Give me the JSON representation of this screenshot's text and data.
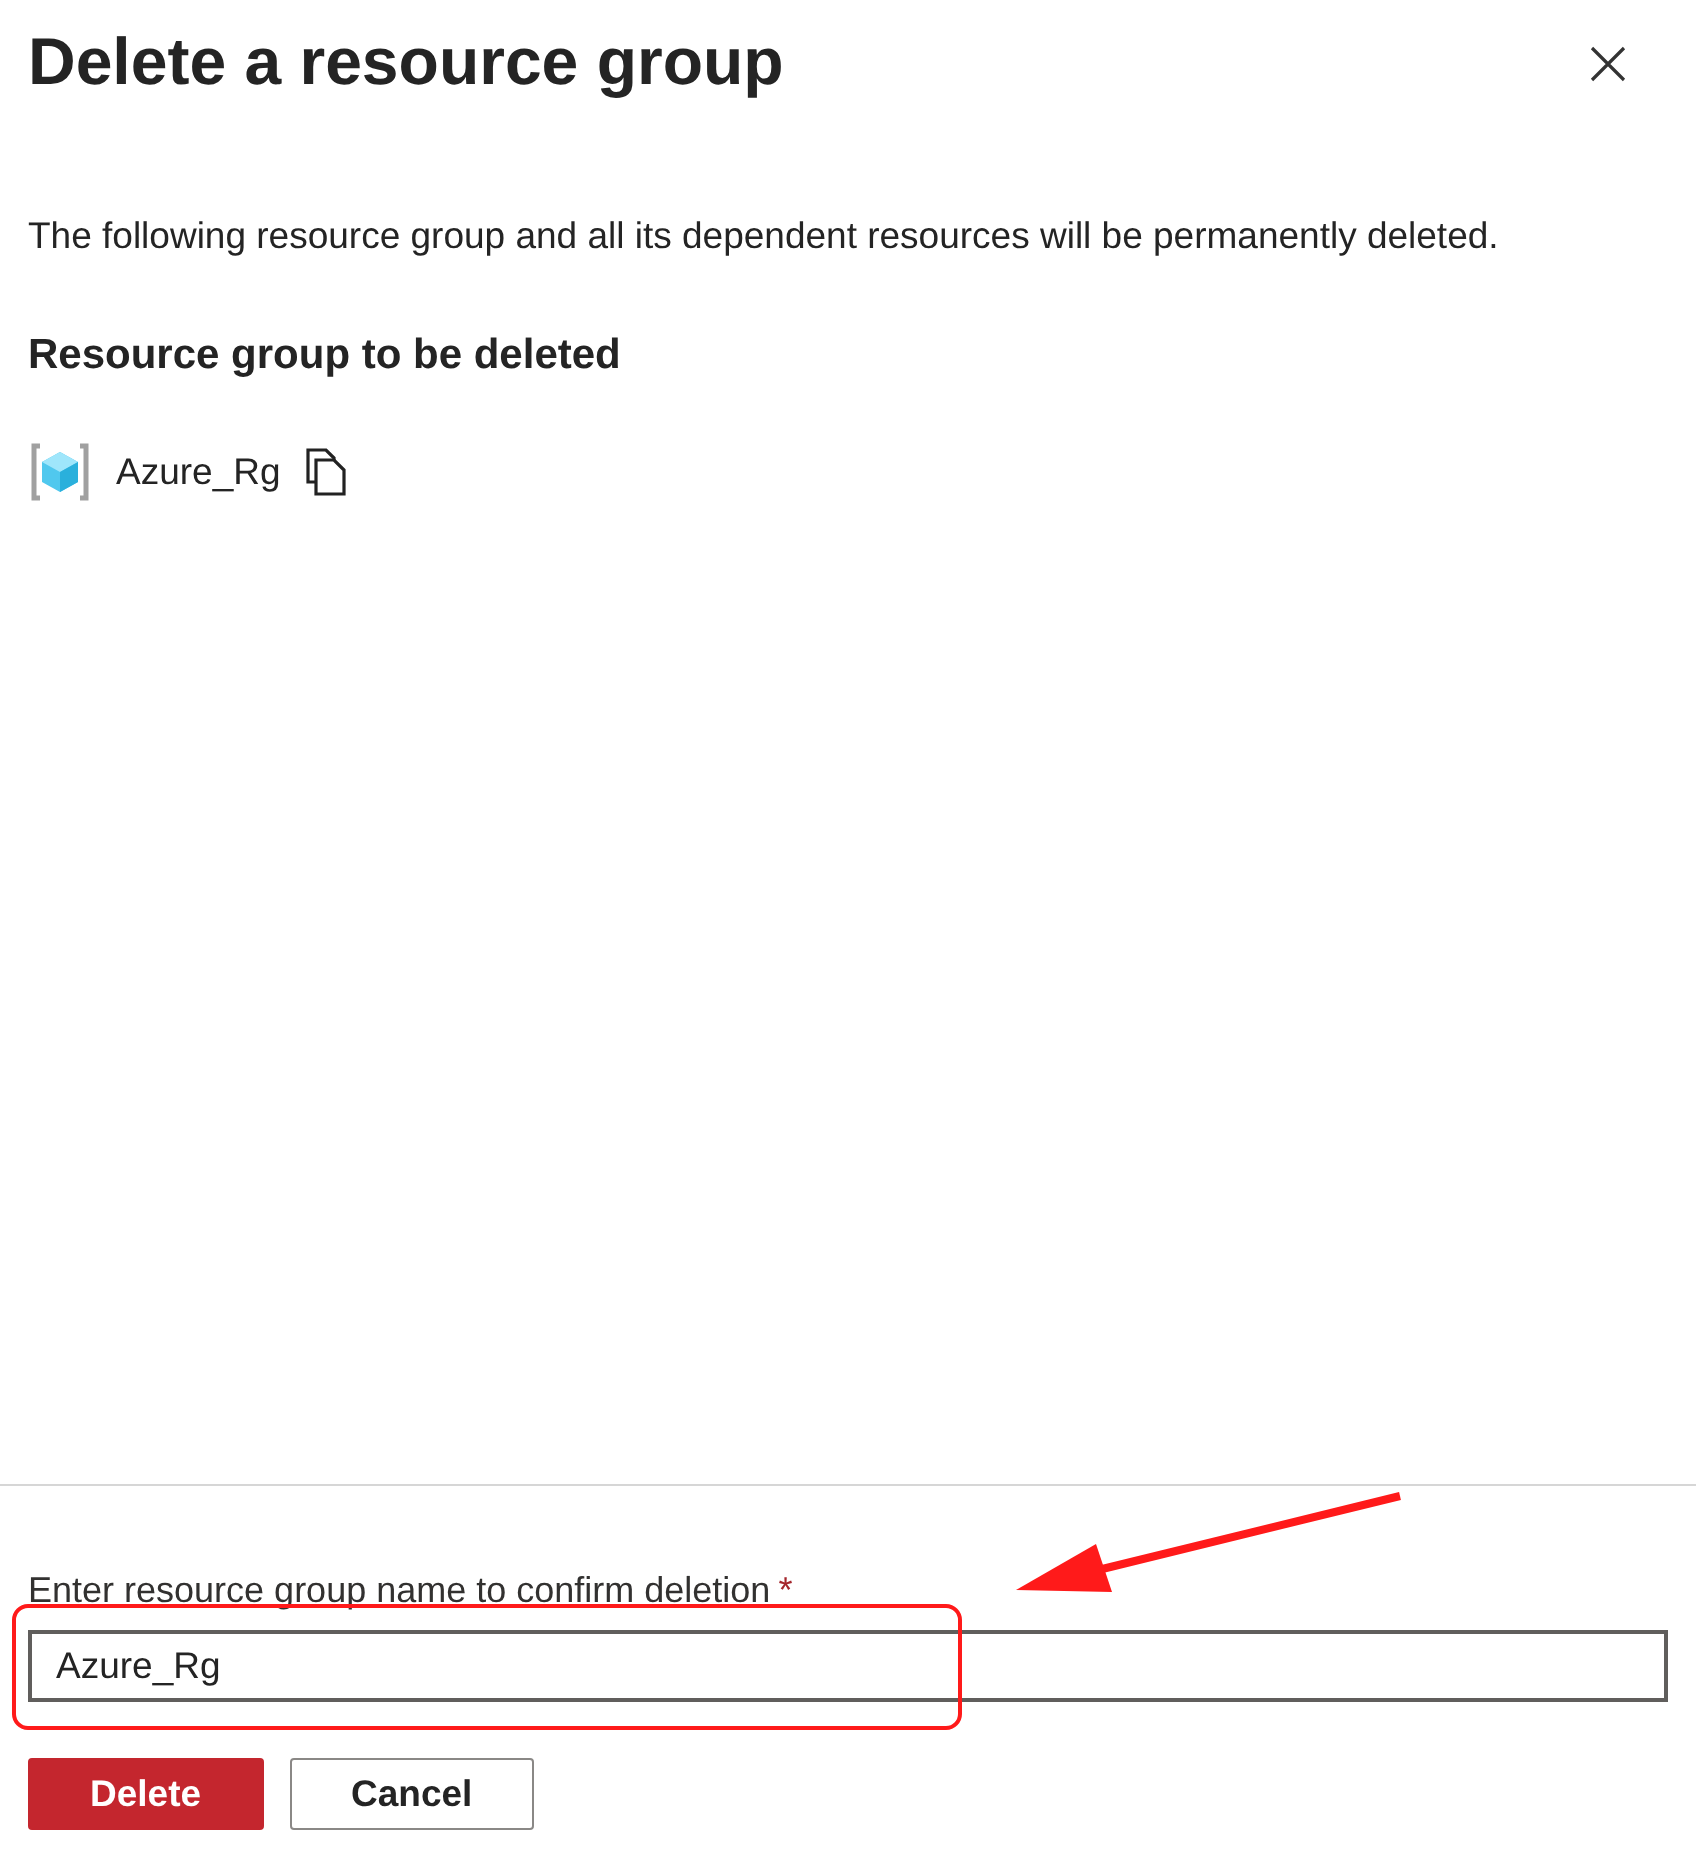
{
  "panel": {
    "title": "Delete a resource group",
    "description": "The following resource group and all its dependent resources will be permanently deleted.",
    "section_heading": "Resource group to be deleted"
  },
  "resource_groups": [
    {
      "name": "Azure_Rg"
    }
  ],
  "confirm": {
    "label": "Enter resource group name to confirm deletion",
    "required_marker": "*",
    "value": "Azure_Rg"
  },
  "buttons": [
    {
      "label": "Delete",
      "kind": "primary"
    },
    {
      "label": "Cancel",
      "kind": "secondary"
    }
  ],
  "annotation": {
    "kind": "highlight"
  }
}
